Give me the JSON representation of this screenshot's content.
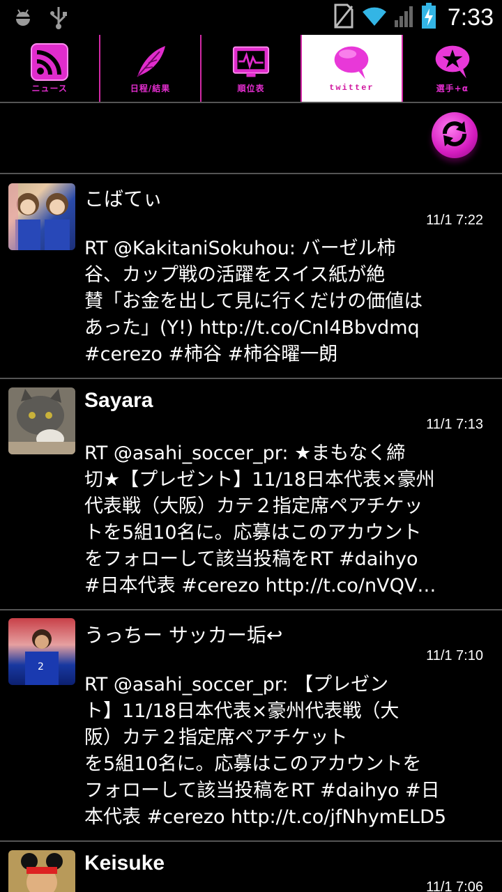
{
  "status_bar": {
    "time": "7:33",
    "icons": [
      "android-debug-icon",
      "usb-icon",
      "no-sim-icon",
      "wifi-icon",
      "signal-icon",
      "battery-charging-icon"
    ]
  },
  "tabs": [
    {
      "label": "ニュース",
      "icon": "rss-icon"
    },
    {
      "label": "日程/結果",
      "icon": "feather-icon"
    },
    {
      "label": "順位表",
      "icon": "pulse-monitor-icon"
    },
    {
      "label": "twitter",
      "icon": "speech-bubble-icon",
      "active": true
    },
    {
      "label": "選手+α",
      "icon": "star-bubble-icon"
    }
  ],
  "toolbar": {
    "refresh_icon": "refresh-icon"
  },
  "tweets": [
    {
      "user": "こばてぃ",
      "time": "11/1 7:22",
      "text": "RT @KakitaniSokuhou: バーゼル柿\n谷、カップ戦の活躍をスイス紙が絶\n賛「お金を出して見に行くだけの価値は\nあった」(Y!) http://t.co/CnI4Bbvdmq\n#cerezo #柿谷 #柿谷曜一朗"
    },
    {
      "user": "Sayara",
      "time": "11/1 7:13",
      "text": "RT @asahi_soccer_pr: ★まもなく締\n切★【プレゼント】11/18日本代表×豪州\n代表戦（大阪）カテ２指定席ペアチケッ\nトを5組10名に。応募はこのアカウント\nをフォローして該当投稿をRT  #daihyo\n#日本代表 #cerezo http://t.co/nVQV…"
    },
    {
      "user": "うっちー サッカー垢↩",
      "time": "11/1 7:10",
      "text": "RT @asahi_soccer_pr: 【プレゼン\nト】11/18日本代表×豪州代表戦（大\n阪）カテ２指定席ペアチケット\nを5組10名に。応募はこのアカウントを\nフォローして該当投稿をRT  #daihyo #日\n本代表 #cerezo http://t.co/jfNhymELD5"
    },
    {
      "user": "Keisuke",
      "time": "11/1 7:06",
      "text": ""
    }
  ]
}
